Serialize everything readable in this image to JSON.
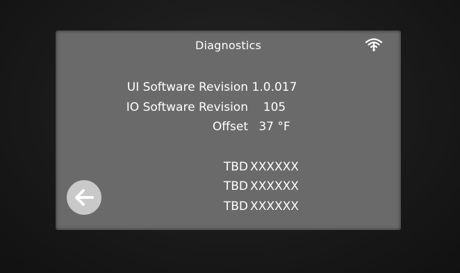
{
  "header": {
    "title": "Diagnostics",
    "wifi_icon": "wifi-icon"
  },
  "rows": [
    {
      "label": "UI Software Revision",
      "value": "1.0.017"
    },
    {
      "label": "IO Software Revision",
      "value": "105"
    },
    {
      "label": "Offset",
      "value": "37 °F"
    },
    {
      "label": "TBD",
      "value": "XXXXXX"
    },
    {
      "label": "TBD",
      "value": "XXXXXX"
    },
    {
      "label": "TBD",
      "value": "XXXXXX"
    }
  ],
  "back_button": {
    "icon": "arrow-left-icon"
  },
  "colors": {
    "screen_background": "#6a6a6a",
    "text": "#ffffff",
    "back_button": "#c9c9c9"
  }
}
